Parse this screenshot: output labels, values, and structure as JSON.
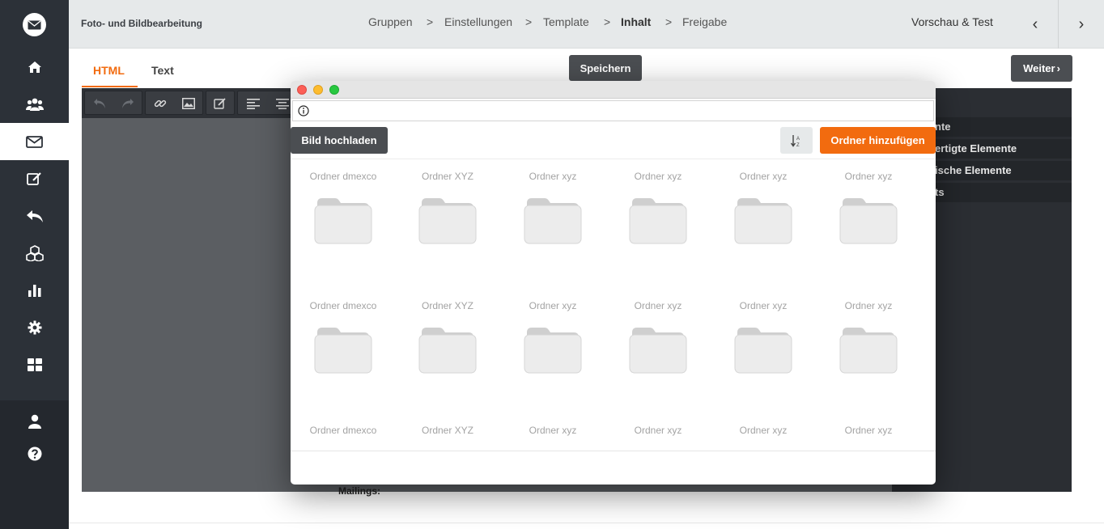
{
  "app": {
    "title": "Foto- und Bildbearbeitung"
  },
  "breadcrumb": [
    {
      "label": "Gruppen",
      "current": false
    },
    {
      "label": "Einstellungen",
      "current": false
    },
    {
      "label": "Template",
      "current": false
    },
    {
      "label": "Inhalt",
      "current": true
    },
    {
      "label": "Freigabe",
      "current": false
    }
  ],
  "breadcrumb_separator": ">",
  "header": {
    "preview_label": "Vorschau & Test",
    "prev_arrow": "‹",
    "next_arrow": "›"
  },
  "sidebar": {
    "logo": "mail-logo-icon",
    "items": [
      {
        "icon": "home-icon",
        "active": false
      },
      {
        "icon": "users-icon",
        "active": false
      },
      {
        "icon": "envelope-icon",
        "active": true
      },
      {
        "icon": "edit-icon",
        "active": false
      },
      {
        "icon": "reply-icon",
        "active": false
      },
      {
        "icon": "cubes-icon",
        "active": false
      },
      {
        "icon": "bar-chart-icon",
        "active": false
      },
      {
        "icon": "gear-icon",
        "active": false
      },
      {
        "icon": "grid-icon",
        "active": false
      }
    ],
    "bottom_items": [
      {
        "icon": "user-icon"
      },
      {
        "icon": "help-icon"
      }
    ]
  },
  "tabs": [
    {
      "label": "HTML",
      "active": true
    },
    {
      "label": "Text",
      "active": false
    }
  ],
  "buttons": {
    "save": "Speichern",
    "next": "Weiter",
    "next_arrow": "›"
  },
  "editor": {
    "toolbar_icons": [
      "undo-icon",
      "redo-icon",
      "link-icon",
      "image-icon",
      "edit-icon",
      "align-left-icon",
      "align-center-icon"
    ],
    "right_panel_items": [
      "nte",
      "ertigte Elemente",
      "ische Elemente",
      "ts"
    ],
    "behind_text": "Mailings:"
  },
  "modal": {
    "url_value": "",
    "upload_button": "Bild hochladen",
    "sort_icon": "sort-alpha-icon",
    "add_folder_button": "Ordner hinzufügen",
    "folders": [
      "Ordner dmexco",
      "Ordner XYZ",
      "Ordner xyz",
      "Ordner xyz",
      "Ordner xyz",
      "Ordner xyz",
      "Ordner dmexco",
      "Ordner XYZ",
      "Ordner xyz",
      "Ordner xyz",
      "Ordner xyz",
      "Ordner xyz",
      "Ordner dmexco",
      "Ordner XYZ",
      "Ordner xyz",
      "Ordner xyz",
      "Ordner xyz",
      "Ordner xyz"
    ]
  },
  "colors": {
    "accent": "#f26b0f",
    "sidebar": "#2c3138",
    "dark_button": "#4b4e52",
    "topbar": "#e6e9ea"
  }
}
